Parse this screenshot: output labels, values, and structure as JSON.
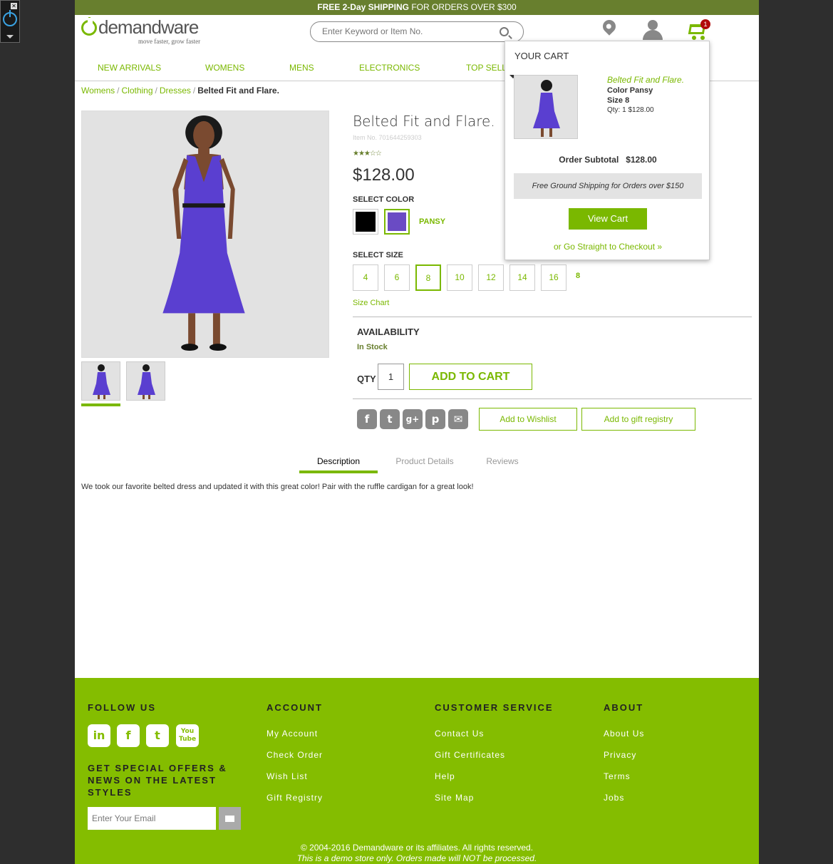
{
  "banner": {
    "bold": "FREE 2-Day SHIPPING",
    "rest": " FOR ORDERS OVER $300"
  },
  "brand": {
    "name": "demandware",
    "tagline": "move faster, grow faster"
  },
  "search": {
    "placeholder": "Enter Keyword or Item No."
  },
  "cart_badge": "1",
  "nav": [
    "NEW ARRIVALS",
    "WOMENS",
    "MENS",
    "ELECTRONICS",
    "TOP SELL"
  ],
  "breadcrumb": {
    "items": [
      "Womens",
      "Clothing",
      "Dresses"
    ],
    "current": "Belted Fit and Flare."
  },
  "product": {
    "title": "Belted Fit and Flare.",
    "item_no": "Item No. 701644259303",
    "rating_stars": "★★★☆☆",
    "price": "$128.00",
    "select_color_label": "SELECT COLOR",
    "colors": [
      {
        "name": "Black",
        "hex": "#000000"
      },
      {
        "name": "Pansy",
        "hex": "#6a4bc4"
      }
    ],
    "selected_color": "PANSY",
    "select_size_label": "SELECT SIZE",
    "sizes": [
      "4",
      "6",
      "8",
      "10",
      "12",
      "14",
      "16"
    ],
    "selected_size": "8",
    "size_chart": "Size Chart",
    "availability_label": "AVAILABILITY",
    "availability": "In Stock",
    "qty_label": "QTY",
    "qty": "1",
    "add_to_cart": "ADD TO CART",
    "wishlist": "Add to Wishlist",
    "gift_registry": "Add to gift registry",
    "dress_color": "#5a3fd0"
  },
  "tabs": [
    "Description",
    "Product Details",
    "Reviews"
  ],
  "description": "We took our favorite belted dress and updated it with this great color! Pair with the ruffle cardigan for a great look!",
  "mini_cart": {
    "title": "YOUR CART",
    "item_name": "Belted Fit and Flare.",
    "item_color": "Color Pansy",
    "item_size": "Size 8",
    "item_qty": "Qty: 1 $128.00",
    "subtotal": "Order Subtotal   $128.00",
    "shipping_note": "Free Ground Shipping for Orders over $150",
    "view_cart": "View Cart",
    "checkout": "or Go Straight to Checkout »"
  },
  "footer": {
    "follow_us": "FOLLOW US",
    "social": [
      "in",
      "f",
      "t",
      "You Tube"
    ],
    "offers": "GET SPECIAL OFFERS & NEWS ON THE LATEST STYLES",
    "email_placeholder": "Enter Your Email",
    "account": {
      "heading": "ACCOUNT",
      "links": [
        "My Account",
        "Check Order",
        "Wish List",
        "Gift Registry"
      ]
    },
    "customer_service": {
      "heading": "CUSTOMER SERVICE",
      "links": [
        "Contact Us",
        "Gift Certificates",
        "Help",
        "Site Map"
      ]
    },
    "about": {
      "heading": "ABOUT",
      "links": [
        "About Us",
        "Privacy",
        "Terms",
        "Jobs"
      ]
    },
    "copyright": "© 2004-2016 Demandware or its affiliates. All rights reserved.",
    "demo_note": "This is a demo store only. Orders made will NOT be processed."
  },
  "accent_color": "#7ab800"
}
